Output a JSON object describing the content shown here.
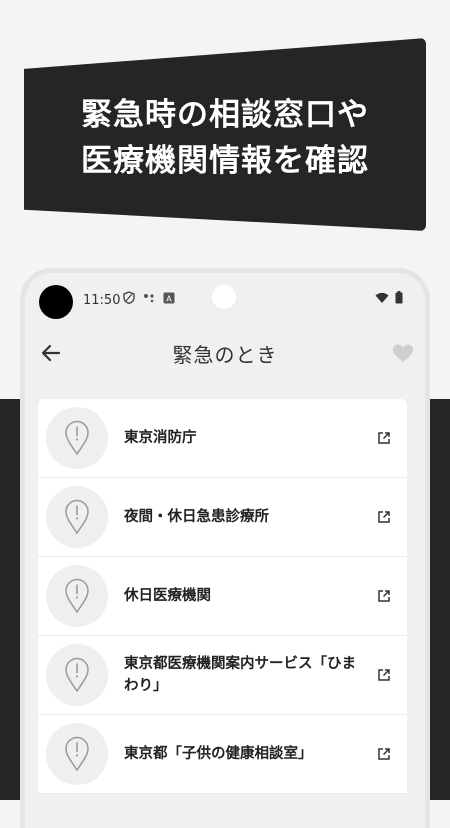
{
  "banner": {
    "line1": "緊急時の相談窓口や",
    "line2": "医療機関情報を確認"
  },
  "status_bar": {
    "time": "11:50",
    "icons": [
      "shield-icon",
      "assistant-icon",
      "translate-icon",
      "wifi-icon",
      "battery-icon"
    ]
  },
  "app_bar": {
    "title": "緊急のとき",
    "back_icon": "arrow-left-icon",
    "favorite_icon": "heart-icon"
  },
  "list": {
    "items": [
      {
        "label": "東京消防庁",
        "icon": "map-pin-exclamation-icon",
        "action_icon": "external-link-icon"
      },
      {
        "label": "夜間・休日急患診療所",
        "icon": "map-pin-exclamation-icon",
        "action_icon": "external-link-icon"
      },
      {
        "label": "休日医療機関",
        "icon": "map-pin-exclamation-icon",
        "action_icon": "external-link-icon"
      },
      {
        "label": "東京都医療機関案内サービス「ひまわり」",
        "icon": "map-pin-exclamation-icon",
        "action_icon": "external-link-icon"
      },
      {
        "label": "東京都「子供の健康相談室」",
        "icon": "map-pin-exclamation-icon",
        "action_icon": "external-link-icon"
      }
    ]
  },
  "colors": {
    "dark": "#242527",
    "background": "#f4f4f4",
    "text": "#222222",
    "icon_grey": "#9a9a9a"
  }
}
